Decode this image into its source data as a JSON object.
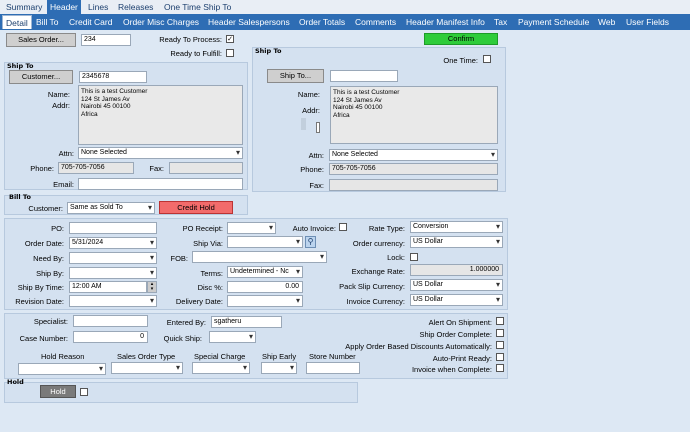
{
  "tabs_top": [
    "Summary",
    "Header",
    "Lines",
    "Releases",
    "One Time Ship To"
  ],
  "tabs_sub": [
    "Detail",
    "Bill To",
    "Credit Card",
    "Order Misc Charges",
    "Header Salespersons",
    "Order Totals",
    "Comments",
    "Header Manifest Info",
    "Tax",
    "Payment Schedule",
    "Web",
    "User Fields"
  ],
  "top": {
    "sales_order_btn": "Sales Order...",
    "sales_order_value": "234",
    "ready_to_process_label": "Ready To Process:",
    "ready_to_process_checked": "✓",
    "ready_to_fulfill_label": "Ready to Fulfill:",
    "confirm_btn": "Confirm"
  },
  "ship_to_left": {
    "section": "Ship To",
    "customer_btn": "Customer...",
    "customer_value": "2345678",
    "name_label": "Name:",
    "addr_label": "Addr:",
    "address_lines": [
      "This is a test Customer",
      "124 St James Av",
      "Nairobi 45 00100",
      "Africa"
    ],
    "attn_label": "Attn:",
    "attn_value": "None Selected",
    "phone_label": "Phone:",
    "phone_value": "705-705-7056",
    "fax_label": "Fax:",
    "email_label": "Email:"
  },
  "ship_to_right": {
    "section": "Ship To",
    "one_time_label": "One Time:",
    "ship_to_btn": "Ship To...",
    "name_label": "Name:",
    "addr_label": "Addr:",
    "address_lines": [
      "This is a test Customer",
      "124 St James Av",
      "Nairobi 45 00100",
      "Africa"
    ],
    "attn_label": "Attn:",
    "attn_value": "None Selected",
    "phone_label": "Phone:",
    "phone_value": "705-705-7056",
    "fax_label": "Fax:"
  },
  "bill_to": {
    "section": "Bill To",
    "customer_label": "Customer:",
    "customer_value": "Same as Sold To",
    "credit_hold_btn": "Credit Hold"
  },
  "order": {
    "po_label": "PO:",
    "order_date_label": "Order Date:",
    "order_date_value": "5/31/2024",
    "need_by_label": "Need By:",
    "ship_by_label": "Ship By:",
    "ship_by_time_label": "Ship By Time:",
    "ship_by_time_value": "12:00 AM",
    "revision_date_label": "Revision Date:",
    "po_receipt_label": "PO Receipt:",
    "ship_via_label": "Ship Via:",
    "fob_label": "FOB:",
    "terms_label": "Terms:",
    "terms_value": "Undetermined - Nc",
    "disc_label": "Disc %:",
    "disc_value": "0.00",
    "delivery_date_label": "Delivery Date:",
    "auto_invoice_label": "Auto Invoice:",
    "rate_type_label": "Rate Type:",
    "rate_type_value": "Conversion",
    "order_currency_label": "Order currency:",
    "order_currency_value": "US Dollar",
    "lock_label": "Lock:",
    "exchange_rate_label": "Exchange Rate:",
    "exchange_rate_value": "1.000000",
    "pack_slip_currency_label": "Pack Slip Currency:",
    "pack_slip_currency_value": "US Dollar",
    "invoice_currency_label": "Invoice Currency:",
    "invoice_currency_value": "US Dollar"
  },
  "misc": {
    "specialist_label": "Specialist:",
    "entered_by_label": "Entered By:",
    "entered_by_value": "sgatheru",
    "case_number_label": "Case Number:",
    "case_number_value": "0",
    "quick_ship_label": "Quick Ship:",
    "alert_on_shipment_label": "Alert On Shipment:",
    "ship_order_complete_label": "Ship Order Complete:",
    "apply_discounts_label": "Apply Order Based Discounts Automatically:",
    "auto_print_ready_label": "Auto-Print Ready:",
    "invoice_when_complete_label": "Invoice when Complete:",
    "hold_reason_label": "Hold Reason",
    "sales_order_type_label": "Sales Order Type",
    "special_charge_label": "Special Charge",
    "ship_early_label": "Ship Early",
    "store_number_label": "Store Number"
  },
  "hold": {
    "section": "Hold",
    "hold_btn": "Hold"
  },
  "colors": {
    "tab_bar": "#2e6db4",
    "confirm": "#2ecc3a",
    "credit_hold": "#f26b6b",
    "panel": "#d4e1f0",
    "hold_btn": "#7a7a7a"
  }
}
